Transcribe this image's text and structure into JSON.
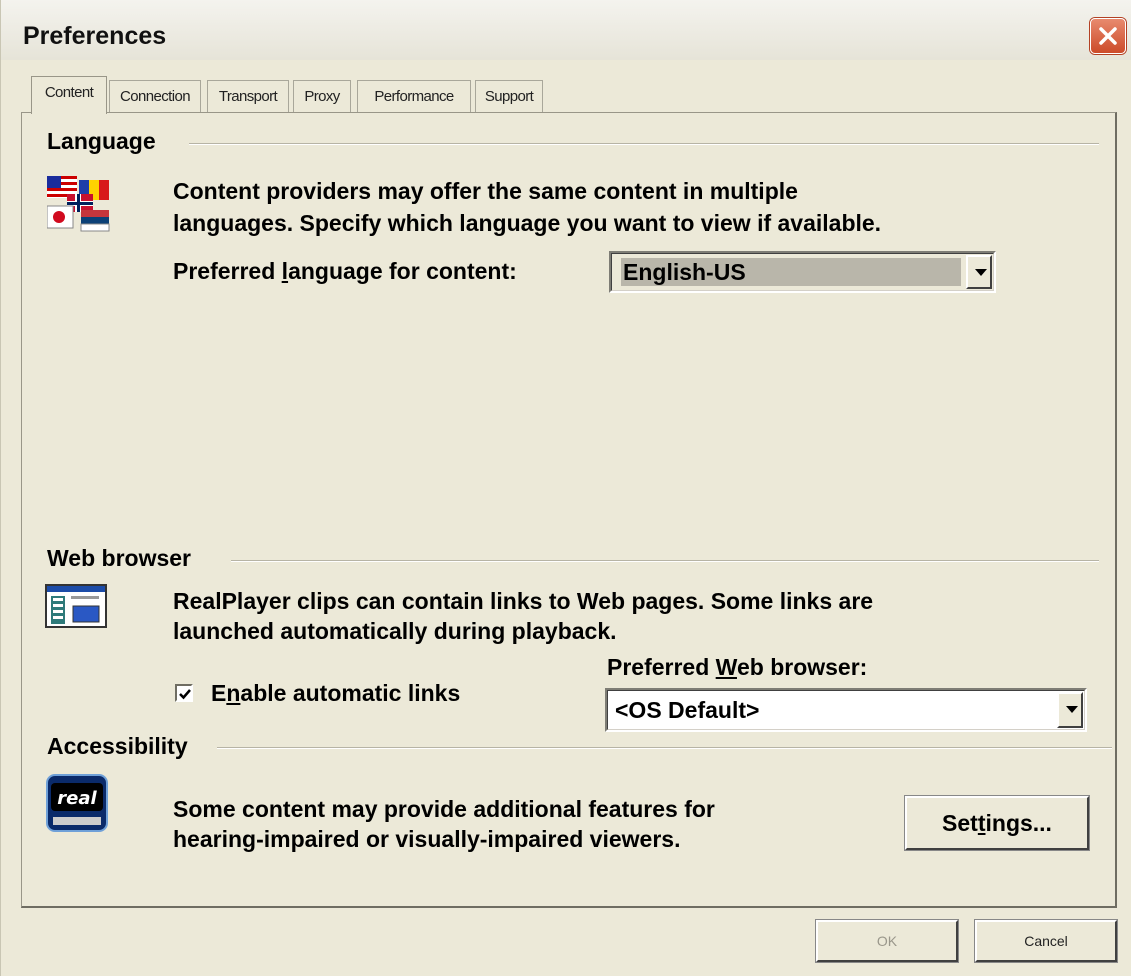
{
  "window": {
    "title": "Preferences"
  },
  "tabs": [
    {
      "label": "Content",
      "active": true
    },
    {
      "label": "Connection"
    },
    {
      "label": "Transport"
    },
    {
      "label": "Proxy"
    },
    {
      "label": "Performance"
    },
    {
      "label": "Support"
    }
  ],
  "language": {
    "heading": "Language",
    "description_line1": "Content providers may offer the same content in multiple",
    "description_line2": "languages. Specify which language you want to view if available.",
    "preferred_label_pre": "Preferred ",
    "preferred_label_key": "l",
    "preferred_label_post": "anguage for content:",
    "selected": "English-US",
    "icon": "flags-icon"
  },
  "web_browser": {
    "heading": "Web browser",
    "description_line1": "RealPlayer clips can contain links to Web pages. Some links are",
    "description_line2": "launched automatically during playback.",
    "checkbox_pre": "E",
    "checkbox_key": "n",
    "checkbox_post": "able automatic links",
    "checkbox_checked": true,
    "browser_label_pre": "Preferred ",
    "browser_label_key": "W",
    "browser_label_post": "eb browser:",
    "selected_browser": "<OS Default>",
    "icon": "web-page-icon"
  },
  "accessibility": {
    "heading": "Accessibility",
    "description_line1": "Some content may provide additional features for",
    "description_line2": "hearing-impaired or visually-impaired viewers.",
    "settings_pre": "Set",
    "settings_key": "t",
    "settings_post": "ings...",
    "logo_text": "real"
  },
  "footer": {
    "ok_label": "OK",
    "cancel_label": "Cancel"
  }
}
